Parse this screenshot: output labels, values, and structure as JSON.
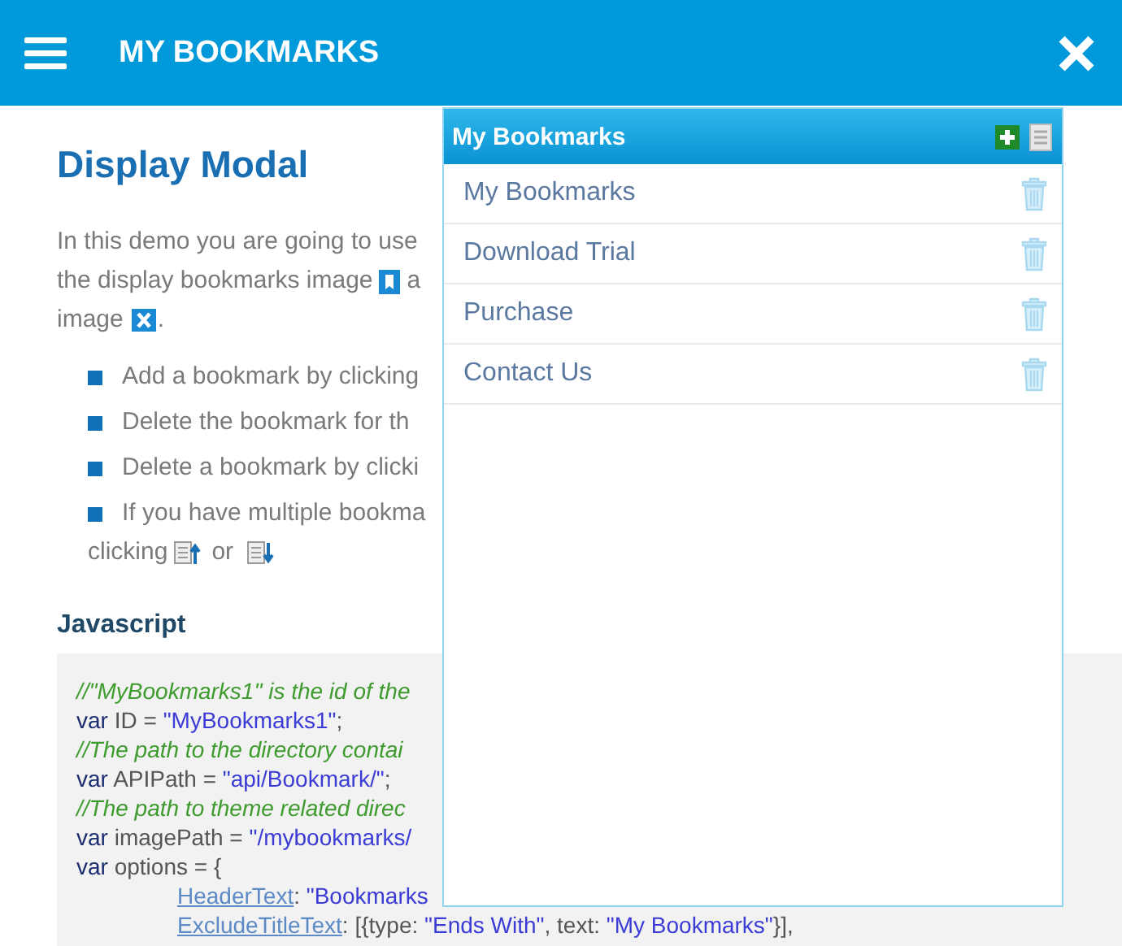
{
  "header": {
    "title": "MY BOOKMARKS"
  },
  "content": {
    "heading": "Display Modal",
    "intro": [
      [
        {
          "kind": "text",
          "text": "In this demo you are going to use"
        }
      ],
      [
        {
          "kind": "text",
          "text": "the display bookmarks image"
        },
        {
          "kind": "bookmark-icon"
        },
        {
          "kind": "text",
          "text": "a"
        }
      ],
      [
        {
          "kind": "text",
          "text": "image"
        },
        {
          "kind": "close-icon"
        },
        {
          "kind": "text",
          "text": "."
        }
      ]
    ],
    "bullets": [
      {
        "text": "Add a bookmark by clicking"
      },
      {
        "text": "Delete the bookmark for th"
      },
      {
        "text": "Delete a bookmark by clicki"
      },
      {
        "text": "If you have multiple bookma",
        "continuation": [
          {
            "kind": "text",
            "text": "clicking"
          },
          {
            "kind": "up-icon"
          },
          {
            "kind": "text",
            "text": "or"
          },
          {
            "kind": "down-icon"
          }
        ]
      }
    ],
    "code_heading": "Javascript",
    "code": [
      {
        "tokens": [
          {
            "kind": "comment",
            "text": "//\"MyBookmarks1\" is the id of the"
          }
        ]
      },
      {
        "tokens": [
          {
            "kind": "keyword",
            "text": "var"
          },
          {
            "kind": "plain",
            "text": " ID = "
          },
          {
            "kind": "string",
            "text": "\"MyBookmarks1\""
          },
          {
            "kind": "plain",
            "text": ";"
          }
        ]
      },
      {
        "tokens": [
          {
            "kind": "comment",
            "text": "//The path to the directory contai"
          }
        ]
      },
      {
        "tokens": [
          {
            "kind": "keyword",
            "text": "var"
          },
          {
            "kind": "plain",
            "text": " APIPath = "
          },
          {
            "kind": "string",
            "text": "\"api/Bookmark/\""
          },
          {
            "kind": "plain",
            "text": ";"
          }
        ]
      },
      {
        "tokens": [
          {
            "kind": "comment",
            "text": "//The path to theme related direc"
          }
        ]
      },
      {
        "tokens": [
          {
            "kind": "keyword",
            "text": "var"
          },
          {
            "kind": "plain",
            "text": " imagePath = "
          },
          {
            "kind": "string",
            "text": "\"/mybookmarks/"
          }
        ]
      },
      {
        "tokens": [
          {
            "kind": "keyword",
            "text": "var"
          },
          {
            "kind": "plain",
            "text": " options = {"
          }
        ]
      },
      {
        "tokens": [
          {
            "kind": "property",
            "text": "HeaderText"
          },
          {
            "kind": "plain",
            "text": ": "
          },
          {
            "kind": "string",
            "text": "\"Bookmarks"
          }
        ]
      },
      {
        "tokens": [
          {
            "kind": "property",
            "text": "ExcludeTitleText"
          },
          {
            "kind": "plain",
            "text": ": [{type: "
          },
          {
            "kind": "string",
            "text": "\"Ends With\""
          },
          {
            "kind": "plain",
            "text": ", text: "
          },
          {
            "kind": "string",
            "text": "\"My Bookmarks\""
          },
          {
            "kind": "plain",
            "text": "}],"
          }
        ]
      }
    ]
  },
  "panel": {
    "title": "My Bookmarks",
    "items": [
      {
        "label": "My Bookmarks"
      },
      {
        "label": "Download Trial"
      },
      {
        "label": "Purchase"
      },
      {
        "label": "Contact Us"
      }
    ]
  }
}
